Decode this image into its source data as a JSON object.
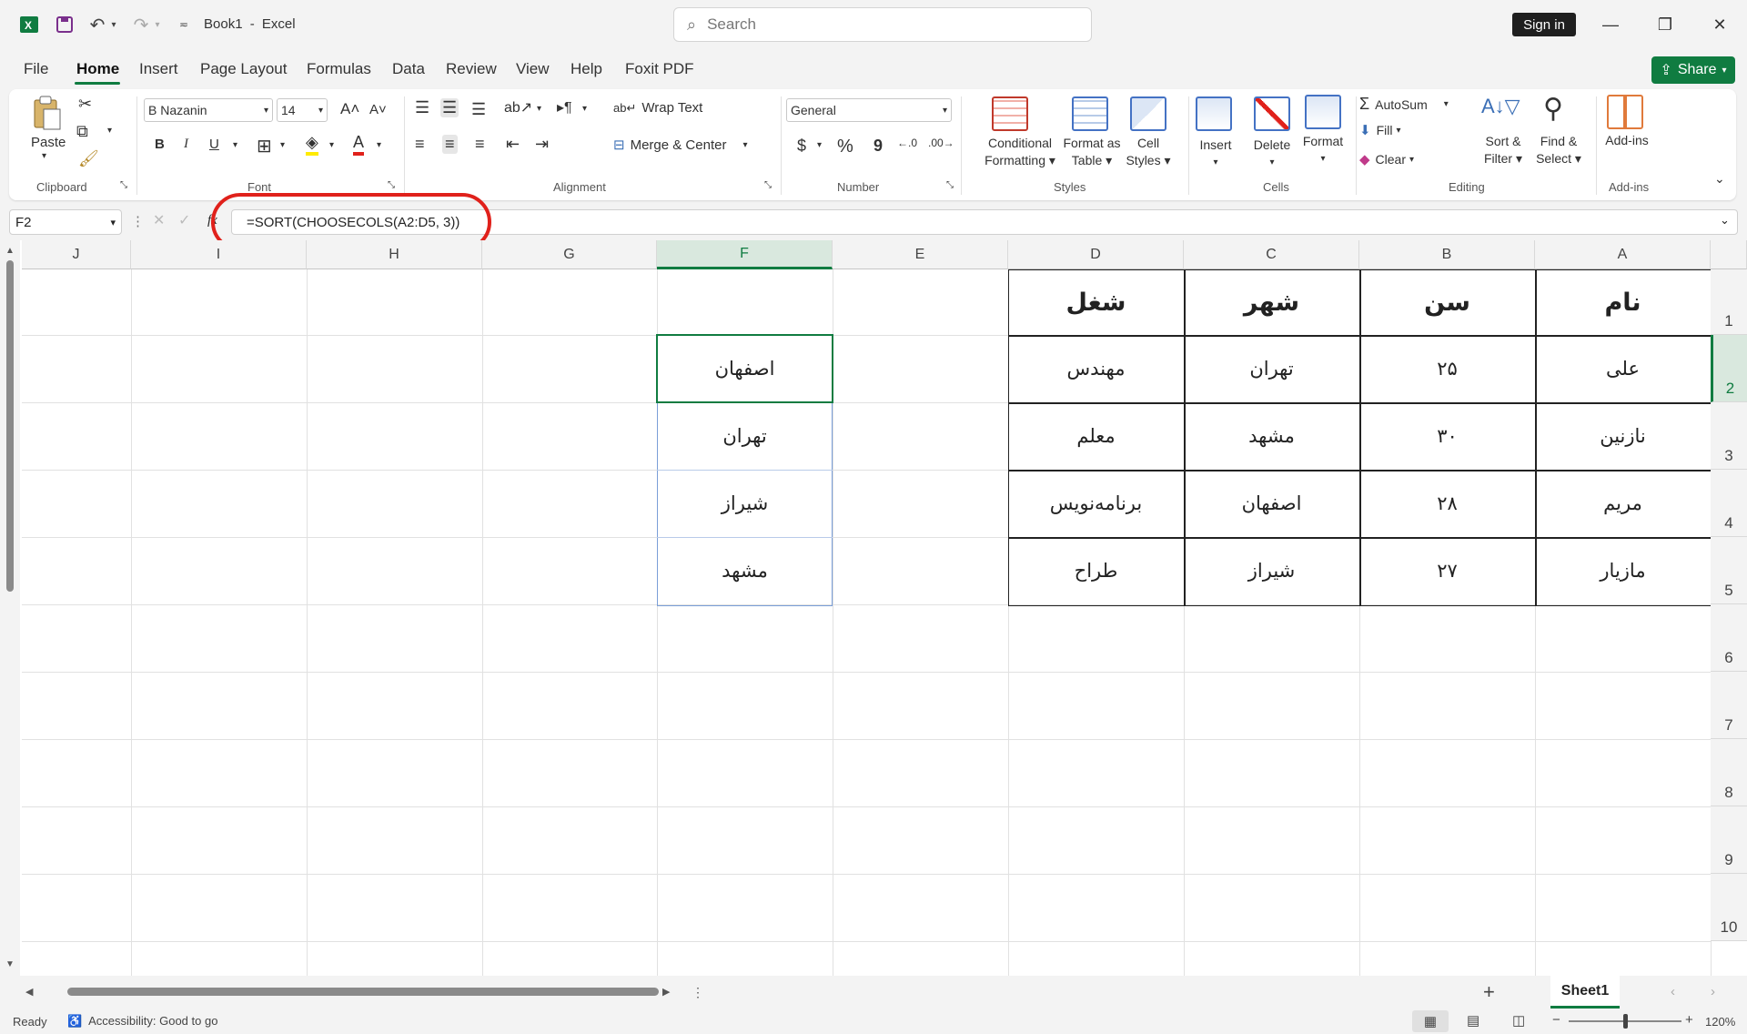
{
  "title": {
    "doc": "Book1",
    "sep": "-",
    "app": "Excel"
  },
  "search": {
    "placeholder": "Search"
  },
  "signin": "Sign in",
  "share": "Share",
  "menu": [
    "File",
    "Home",
    "Insert",
    "Page Layout",
    "Formulas",
    "Data",
    "Review",
    "View",
    "Help",
    "Foxit PDF"
  ],
  "ribbon": {
    "clipboard": {
      "paste": "Paste",
      "label": "Clipboard"
    },
    "font": {
      "name": "B Nazanin",
      "size": "14",
      "bold": "B",
      "italic": "I",
      "underline": "U",
      "label": "Font"
    },
    "alignment": {
      "wrap": "Wrap Text",
      "merge": "Merge & Center",
      "label": "Alignment"
    },
    "number": {
      "format": "General",
      "currency": "$",
      "percent": "%",
      "comma": "9",
      "label": "Number"
    },
    "styles": {
      "conditional": "Conditional",
      "conditional2": "Formatting",
      "format_as": "Format as",
      "format_as2": "Table",
      "cell": "Cell",
      "cell2": "Styles",
      "label": "Styles"
    },
    "cells": {
      "insert": "Insert",
      "delete": "Delete",
      "format": "Format",
      "label": "Cells"
    },
    "editing": {
      "autosum": "AutoSum",
      "fill": "Fill",
      "clear": "Clear",
      "sort": "Sort &",
      "sort2": "Filter",
      "find": "Find &",
      "find2": "Select",
      "label": "Editing"
    },
    "addins": {
      "btn": "Add-ins",
      "label": "Add-ins"
    }
  },
  "formula": {
    "namebox": "F2",
    "value": "=SORT(CHOOSECOLS(A2:D5, 3))",
    "fx": "fx"
  },
  "columns": [
    "J",
    "I",
    "H",
    "G",
    "F",
    "E",
    "D",
    "C",
    "B",
    "A"
  ],
  "rows": [
    "1",
    "2",
    "3",
    "4",
    "5",
    "6",
    "7",
    "8",
    "9",
    "10"
  ],
  "table": {
    "header": {
      "A": "نام",
      "B": "سن",
      "C": "شهر",
      "D": "شغل"
    },
    "rows": [
      {
        "A": "علی",
        "B": "۲۵",
        "C": "تهران",
        "D": "مهندس"
      },
      {
        "A": "نازنین",
        "B": "۳۰",
        "C": "مشهد",
        "D": "معلم"
      },
      {
        "A": "مریم",
        "B": "۲۸",
        "C": "اصفهان",
        "D": "برنامه‌نویس"
      },
      {
        "A": "مازیار",
        "B": "۲۷",
        "C": "شیراز",
        "D": "طراح"
      }
    ]
  },
  "spill": [
    "اصفهان",
    "تهران",
    "شیراز",
    "مشهد"
  ],
  "sheet": "Sheet1",
  "status": {
    "ready": "Ready",
    "accessibility": "Accessibility: Good to go",
    "zoom": "120%"
  },
  "colors": {
    "accent": "#107c41",
    "highlight": "#e0211b",
    "spill_border": "#7a9ed8"
  }
}
